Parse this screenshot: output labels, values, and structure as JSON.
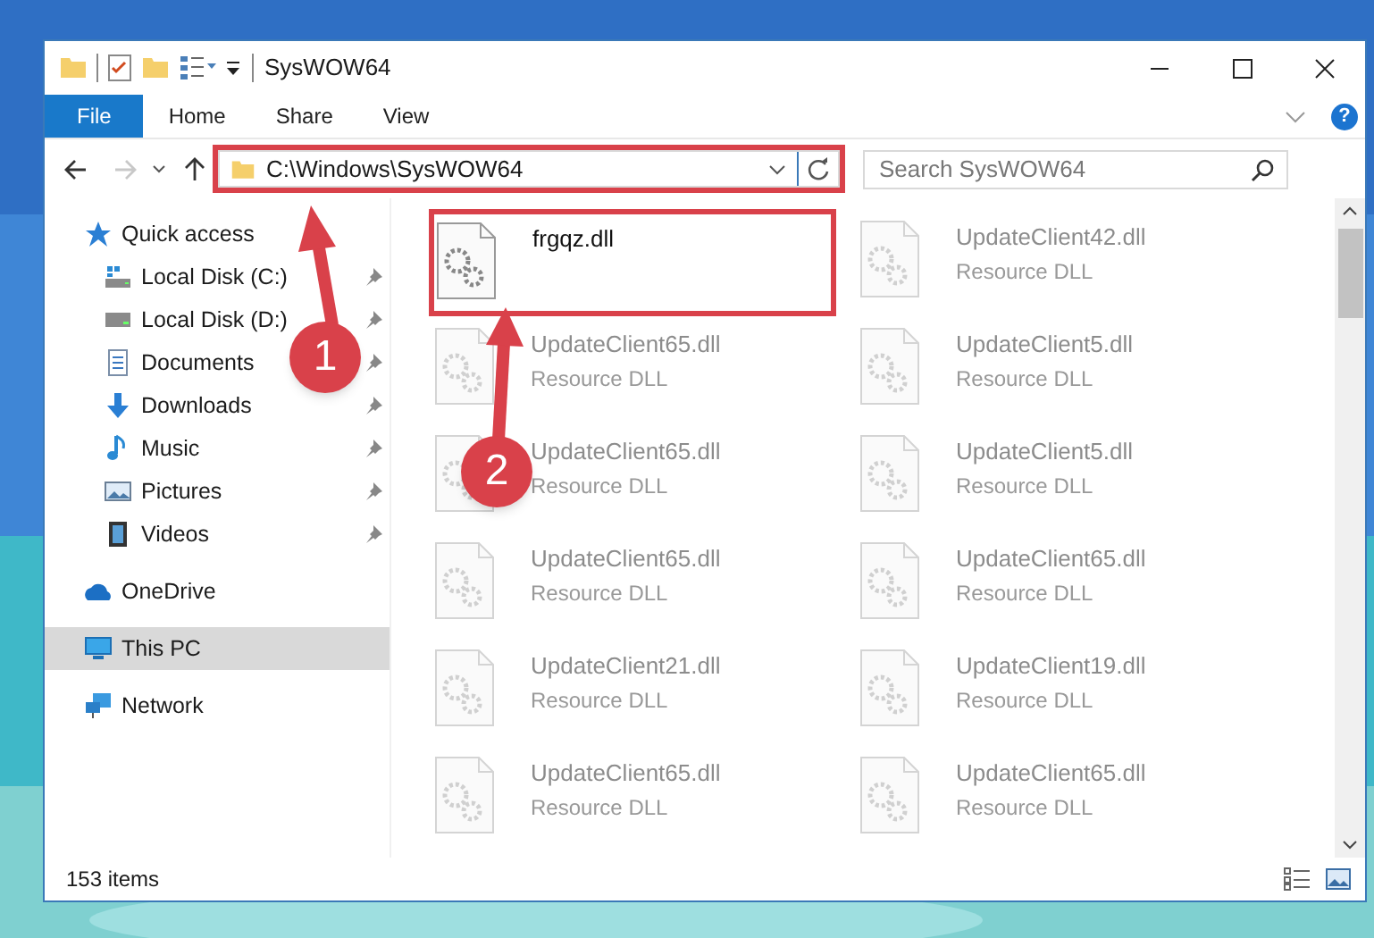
{
  "window": {
    "title": "SysWOW64"
  },
  "ribbon": {
    "tabs": [
      {
        "label": "File",
        "selected": true
      },
      {
        "label": "Home",
        "selected": false
      },
      {
        "label": "Share",
        "selected": false
      },
      {
        "label": "View",
        "selected": false
      }
    ],
    "help_icon": "?"
  },
  "address_bar": {
    "path": "C:\\Windows\\SysWOW64",
    "forward_disabled": true,
    "highlighted": true
  },
  "search": {
    "placeholder": "Search SysWOW64"
  },
  "navigation": {
    "items": [
      {
        "label": "Quick access",
        "kind": "star",
        "selected": false,
        "children": [
          {
            "label": "Local Disk (C:)",
            "kind": "system-drive",
            "pinned": true,
            "selected": false
          },
          {
            "label": "Local Disk (D:)",
            "kind": "drive",
            "pinned": true,
            "selected": false
          },
          {
            "label": "Documents",
            "kind": "documents",
            "pinned": true,
            "selected": false
          },
          {
            "label": "Downloads",
            "kind": "downloads",
            "pinned": true,
            "selected": false
          },
          {
            "label": "Music",
            "kind": "music",
            "pinned": true,
            "selected": false
          },
          {
            "label": "Pictures",
            "kind": "pictures",
            "pinned": true,
            "selected": false
          },
          {
            "label": "Videos",
            "kind": "videos",
            "pinned": true,
            "selected": false
          }
        ]
      },
      {
        "label": "OneDrive",
        "kind": "cloud",
        "selected": false
      },
      {
        "label": "This PC",
        "kind": "computer",
        "selected": true
      },
      {
        "label": "Network",
        "kind": "network",
        "selected": false
      }
    ]
  },
  "files": [
    {
      "name": "frgqz.dll",
      "faded": false,
      "highlighted": true
    },
    {
      "name": "UpdateClient42.dll",
      "type": "Resource DLL",
      "faded": true,
      "highlighted": false
    },
    {
      "name": "UpdateClient65.dll",
      "type": "Resource DLL",
      "faded": true,
      "highlighted": false
    },
    {
      "name": "UpdateClient5.dll",
      "type": "Resource DLL",
      "faded": true,
      "highlighted": false
    },
    {
      "name": "UpdateClient65.dll",
      "type": "Resource DLL",
      "faded": true,
      "highlighted": false
    },
    {
      "name": "UpdateClient5.dll",
      "type": "Resource DLL",
      "faded": true,
      "highlighted": false
    },
    {
      "name": "UpdateClient65.dll",
      "type": "Resource DLL",
      "faded": true,
      "highlighted": false
    },
    {
      "name": "UpdateClient65.dll",
      "type": "Resource DLL",
      "faded": true,
      "highlighted": false
    },
    {
      "name": "UpdateClient21.dll",
      "type": "Resource DLL",
      "faded": true,
      "highlighted": false
    },
    {
      "name": "UpdateClient19.dll",
      "type": "Resource DLL",
      "faded": true,
      "highlighted": false
    },
    {
      "name": "UpdateClient65.dll",
      "type": "Resource DLL",
      "faded": true,
      "highlighted": false
    },
    {
      "name": "UpdateClient65.dll",
      "type": "Resource DLL",
      "faded": true,
      "highlighted": false
    }
  ],
  "status_bar": {
    "item_count": "153 items"
  },
  "annotations": [
    {
      "label": "1"
    },
    {
      "label": "2"
    }
  ]
}
